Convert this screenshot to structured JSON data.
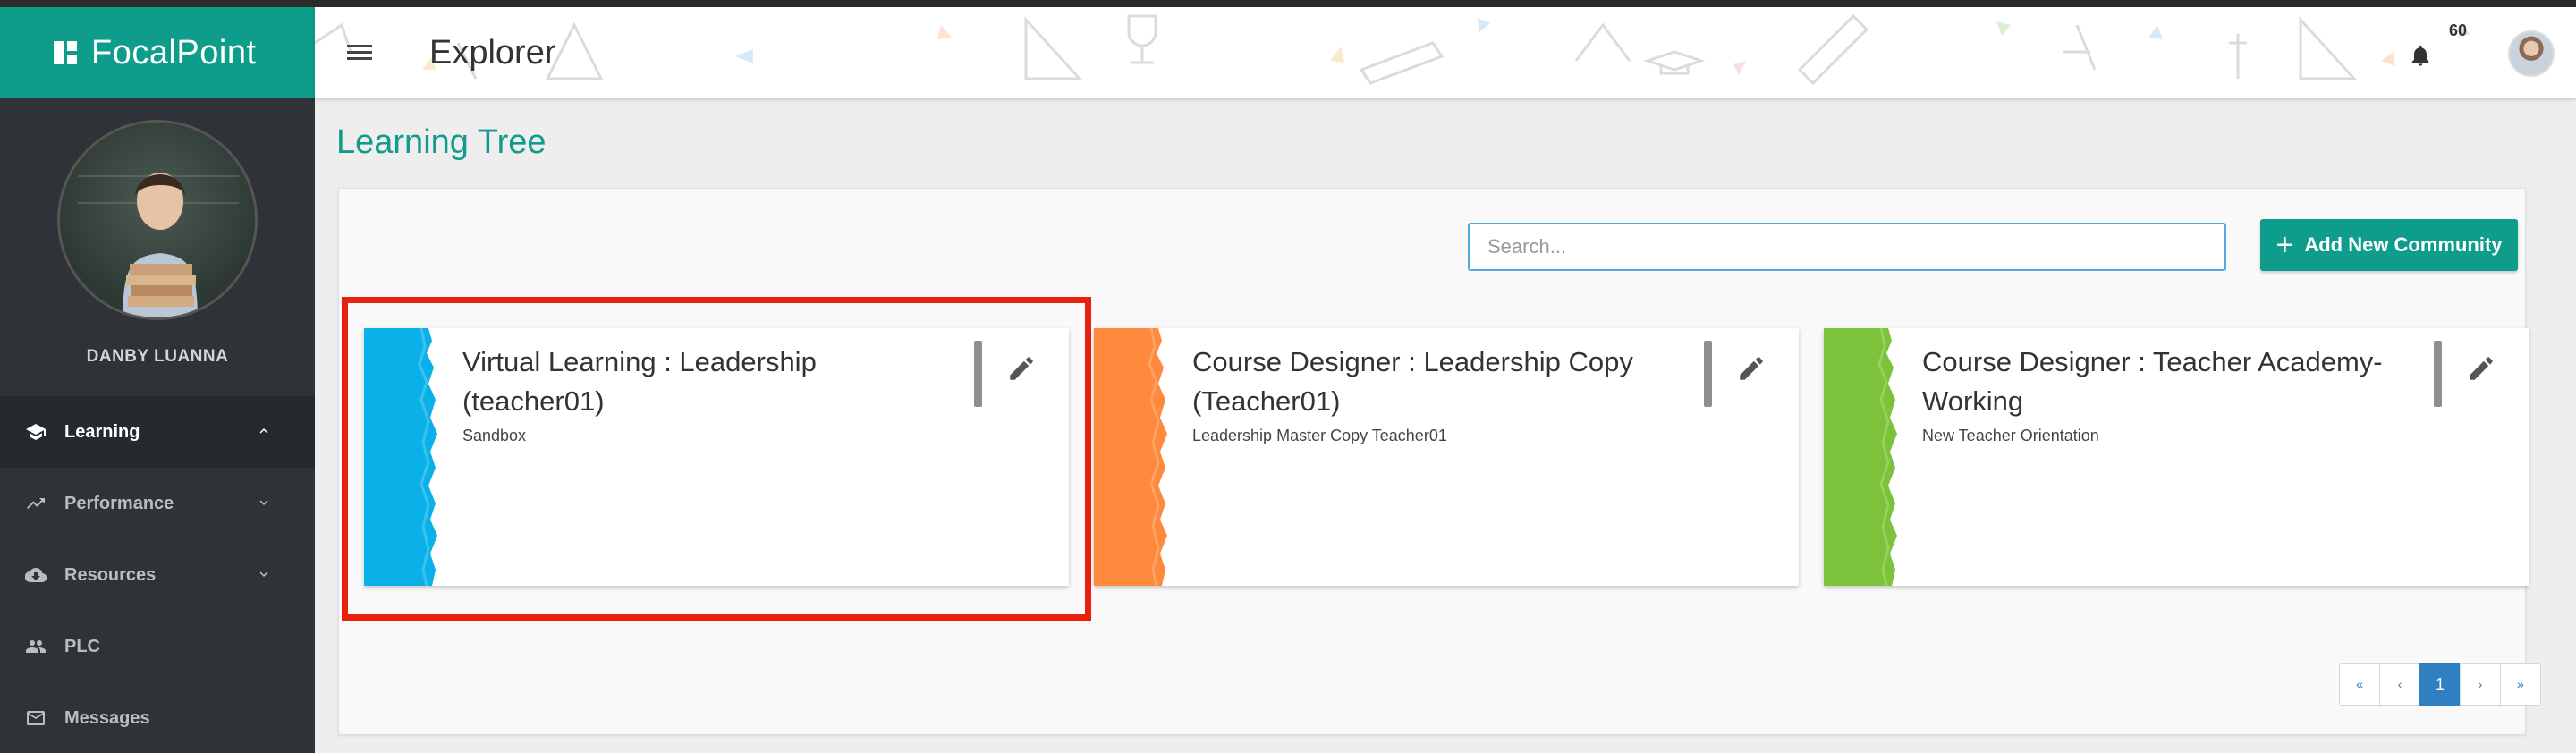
{
  "app": {
    "name": "FocalPoint"
  },
  "header": {
    "page_title": "Explorer",
    "notification_count": "60"
  },
  "profile": {
    "name": "DANBY LUANNA"
  },
  "sidebar": {
    "items": [
      {
        "label": "Learning",
        "icon": "graduation-cap-icon",
        "expanded": true
      },
      {
        "label": "Performance",
        "icon": "trending-up-icon"
      },
      {
        "label": "Resources",
        "icon": "cloud-download-icon"
      },
      {
        "label": "PLC",
        "icon": "people-icon"
      },
      {
        "label": "Messages",
        "icon": "mail-icon"
      }
    ]
  },
  "main": {
    "section_title": "Learning Tree",
    "search": {
      "placeholder": "Search...",
      "value": ""
    },
    "add_button_label": "Add New Community",
    "cards": [
      {
        "title": "Virtual Learning : Leadership (teacher01)",
        "subtitle": "Sandbox",
        "color": "#0ab0e8",
        "highlighted": true
      },
      {
        "title": "Course Designer : Leadership Copy (Teacher01)",
        "subtitle": "Leadership Master Copy Teacher01",
        "color": "#ff8a3d"
      },
      {
        "title": "Course Designer : Teacher Academy-Working",
        "subtitle": "New Teacher Orientation",
        "color": "#7cc23a"
      }
    ],
    "pagination": {
      "first": "«",
      "prev": "‹",
      "current": "1",
      "next": "›",
      "last": "»"
    }
  },
  "colors": {
    "brand": "#0e9d8a",
    "sidebar": "#2f3337",
    "highlight": "#e8210f",
    "accent_link": "#2f7fc1"
  }
}
